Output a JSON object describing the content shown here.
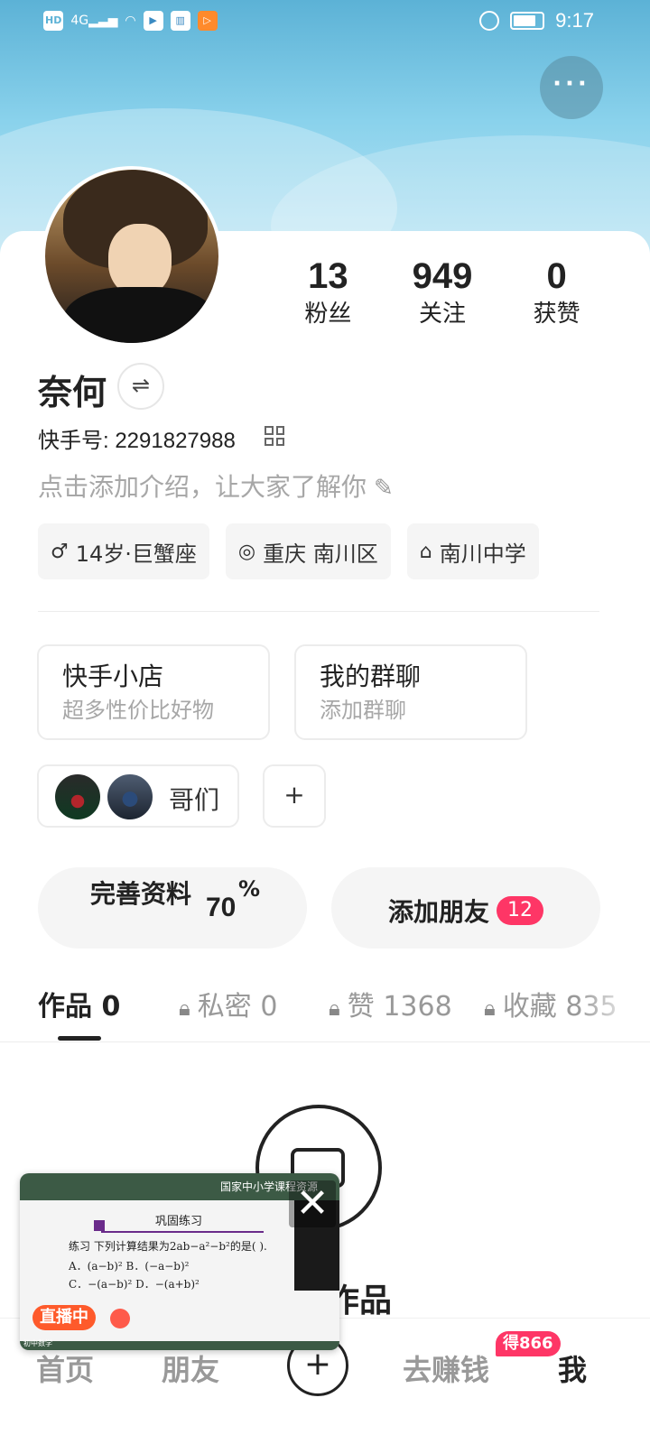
{
  "status_bar": {
    "hd": "HD",
    "signal": "4G",
    "time": "9:17",
    "icons": [
      "hd-icon",
      "signal-icon",
      "wifi-icon",
      "app-icon",
      "book-icon",
      "video-icon",
      "alarm-icon",
      "battery-icon"
    ]
  },
  "header": {
    "more_label": "···",
    "colors": {
      "sky": "#8ad2ec"
    }
  },
  "stats": [
    {
      "value": "13",
      "label": "粉丝"
    },
    {
      "value": "949",
      "label": "关注"
    },
    {
      "value": "0",
      "label": "获赞"
    }
  ],
  "profile": {
    "name": "奈何",
    "switch_symbol": "⇌",
    "uid": "快手号: 2291827988",
    "intro": "点击添加介绍，让大家了解你",
    "tags": [
      {
        "icon": "male-icon",
        "symbol": "♂",
        "label": "14岁·巨蟹座"
      },
      {
        "icon": "location-icon",
        "symbol": "◎",
        "label": "重庆 南川区"
      },
      {
        "icon": "school-icon",
        "symbol": "⌂",
        "label": "南川中学"
      }
    ]
  },
  "entries": [
    {
      "title": "快手小店",
      "subtitle": "超多性价比好物"
    },
    {
      "title": "我的群聊",
      "subtitle": "添加群聊"
    }
  ],
  "group": {
    "label": "哥们",
    "add_symbol": "+"
  },
  "actions": {
    "complete": {
      "label": "完善资料",
      "percent": "70",
      "percent_sign": "%"
    },
    "add_friend": {
      "label": "添加朋友",
      "badge": "12"
    }
  },
  "tabs": [
    {
      "label": "作品 0",
      "active": true
    },
    {
      "label": "私密 0",
      "locked": true
    },
    {
      "label": "赞 1368",
      "locked": true
    },
    {
      "label": "收藏 835",
      "locked": true
    }
  ],
  "empty": {
    "text": "作品"
  },
  "live_window": {
    "top_text": "国家中小学课程资源",
    "heading": "巩固练习",
    "lines": [
      "练习 下列计算结果为2ab−a²−b²的是(    ).",
      "A．(a−b)²        B．(−a−b)²",
      "C．−(a−b)²       D．−(a+b)²"
    ],
    "badge": "直播中",
    "corner": "初中数学",
    "close_symbol": "✕"
  },
  "bottom_nav": {
    "items": [
      {
        "label": "首页"
      },
      {
        "label": "朋友"
      },
      {
        "label": "去赚钱"
      },
      {
        "label": "我",
        "active": true
      }
    ],
    "plus": "+",
    "earn_badge": "得866"
  },
  "colors": {
    "accent": "#fe3666",
    "live": "#fe5a2b",
    "text": "#222222",
    "muted": "#a7a7a7"
  }
}
